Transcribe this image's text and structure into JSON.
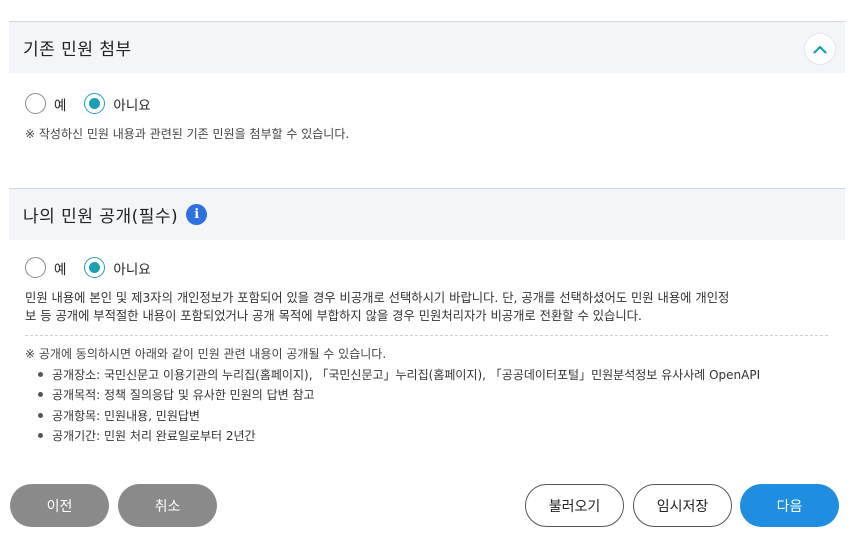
{
  "section1": {
    "title": "기존 민원 첨부",
    "options": [
      "예",
      "아니요"
    ],
    "selected": "아니요",
    "note": "※ 작성하신 민원 내용과 관련된 기존 민원을 첨부할 수 있습니다."
  },
  "section2": {
    "title": "나의 민원 공개(필수)",
    "info_glyph": "i",
    "options": [
      "예",
      "아니요"
    ],
    "selected": "아니요",
    "desc_line1": "민원 내용에 본인 및 제3자의 개인정보가 포함되어 있을 경우 비공개로 선택하시기 바랍니다. 단, 공개를 선택하셨어도 민원 내용에 개인정",
    "desc_line2": "보 등 공개에 부적절한 내용이 포함되었거나 공개 목적에 부합하지 않을 경우 민원처리자가 비공개로 전환할 수 있습니다.",
    "note": "※ 공개에 동의하시면 아래와 같이 민원 관련 내용이 공개될 수 있습니다.",
    "bullets": [
      "공개장소: 국민신문고 이용기관의 누리집(홈페이지), 「국민신문고」누리집(홈페이지), 「공공데이터포털」민원분석정보 유사사례 OpenAPI",
      "공개목적: 정책 질의응답 및 유사한 민원의 답변 참고",
      "공개항목: 민원내용, 민원답변",
      "공개기간: 민원 처리 완료일로부터 2년간"
    ]
  },
  "buttons": {
    "prev": "이전",
    "cancel": "취소",
    "load": "불러오기",
    "temp_save": "임시저장",
    "next": "다음"
  },
  "icons": {
    "collapse": "chevron-up-icon",
    "info": "info-icon"
  },
  "colors": {
    "accent": "#1a9fb3",
    "primary_button": "#1f8ee0",
    "gray_button": "#8a8a8a",
    "info_icon": "#2f6fe0"
  }
}
